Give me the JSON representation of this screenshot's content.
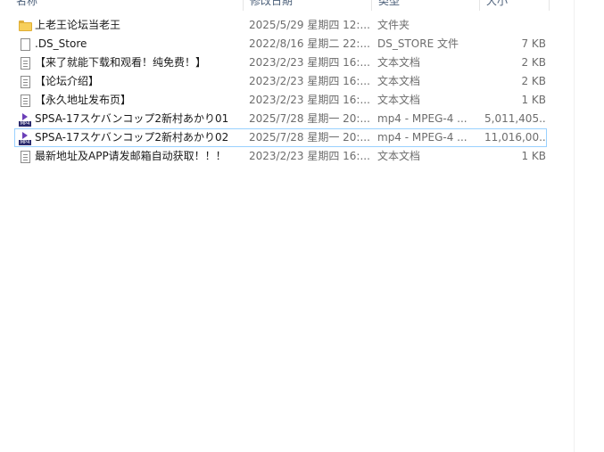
{
  "columns": {
    "name": "名称",
    "date": "修改日期",
    "type": "类型",
    "size": "大小"
  },
  "files": [
    {
      "icon": "folder-icon",
      "name": "上老王论坛当老王",
      "date": "2025/5/29 星期四 12:...",
      "type": "文件夹",
      "size": ""
    },
    {
      "icon": "file-icon",
      "name": ".DS_Store",
      "date": "2022/8/16 星期二 22:...",
      "type": "DS_STORE 文件",
      "size": "7 KB"
    },
    {
      "icon": "text-document-icon",
      "name": "【来了就能下载和观看！纯免费！】",
      "date": "2023/2/23 星期四 16:...",
      "type": "文本文档",
      "size": "2 KB"
    },
    {
      "icon": "text-document-icon",
      "name": "【论坛介绍】",
      "date": "2023/2/23 星期四 16:...",
      "type": "文本文档",
      "size": "2 KB"
    },
    {
      "icon": "text-document-icon",
      "name": "【永久地址发布页】",
      "date": "2023/2/23 星期四 16:...",
      "type": "文本文档",
      "size": "1 KB"
    },
    {
      "icon": "mp4-video-icon",
      "name": "SPSA-17スケバンコップ2新村あかり01",
      "date": "2025/7/28 星期一 20:...",
      "type": "mp4 - MPEG-4 ...",
      "size": "5,011,405..."
    },
    {
      "icon": "mp4-video-icon",
      "name": "SPSA-17スケバンコップ2新村あかり02",
      "date": "2025/7/28 星期一 20:...",
      "type": "mp4 - MPEG-4 ...",
      "size": "11,016,00...",
      "selected": true
    },
    {
      "icon": "text-document-icon",
      "name": "最新地址及APP请发邮箱自动获取！！！",
      "date": "2023/2/23 星期四 16:...",
      "type": "文本文档",
      "size": "1 KB"
    }
  ],
  "mp4_label": "MP4",
  "colors": {
    "selection_border": "#99d1ff",
    "folder": "#f7cf5a",
    "meta_text": "#6d6d6d",
    "header_text": "#4c607a"
  }
}
